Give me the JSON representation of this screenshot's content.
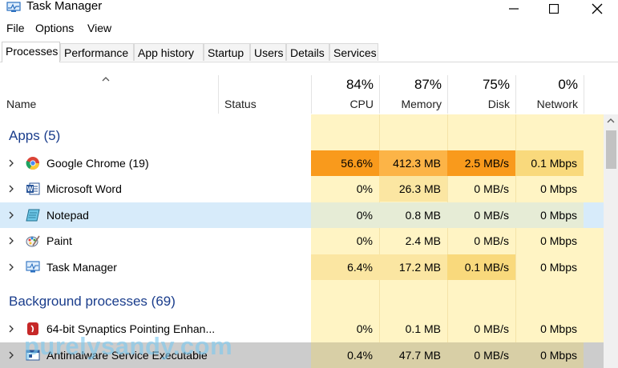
{
  "window": {
    "title": "Task Manager"
  },
  "menu": [
    "File",
    "Options",
    "View"
  ],
  "tabs": [
    "Processes",
    "Performance",
    "App history",
    "Startup",
    "Users",
    "Details",
    "Services"
  ],
  "columns": {
    "name": "Name",
    "status": "Status",
    "cpu": {
      "pct": "84%",
      "label": "CPU"
    },
    "memory": {
      "pct": "87%",
      "label": "Memory"
    },
    "disk": {
      "pct": "75%",
      "label": "Disk"
    },
    "network": {
      "pct": "0%",
      "label": "Network"
    }
  },
  "groups": {
    "apps": "Apps (5)",
    "background": "Background processes (69)"
  },
  "apps": [
    {
      "name": "Google Chrome (19)",
      "cpu": "56.6%",
      "memory": "412.3 MB",
      "disk": "2.5 MB/s",
      "network": "0.1 Mbps",
      "icon": "chrome-icon"
    },
    {
      "name": "Microsoft Word",
      "cpu": "0%",
      "memory": "26.3 MB",
      "disk": "0 MB/s",
      "network": "0 Mbps",
      "icon": "word-icon"
    },
    {
      "name": "Notepad",
      "cpu": "0%",
      "memory": "0.8 MB",
      "disk": "0 MB/s",
      "network": "0 Mbps",
      "icon": "notepad-icon"
    },
    {
      "name": "Paint",
      "cpu": "0%",
      "memory": "2.4 MB",
      "disk": "0 MB/s",
      "network": "0 Mbps",
      "icon": "paint-icon"
    },
    {
      "name": "Task Manager",
      "cpu": "6.4%",
      "memory": "17.2 MB",
      "disk": "0.1 MB/s",
      "network": "0 Mbps",
      "icon": "task-manager-icon"
    }
  ],
  "background": [
    {
      "name": "64-bit Synaptics Pointing Enhan...",
      "cpu": "0%",
      "memory": "0.1 MB",
      "disk": "0 MB/s",
      "network": "0 Mbps",
      "icon": "synaptics-icon"
    },
    {
      "name": "Antimalware Service Executable",
      "cpu": "0.4%",
      "memory": "47.7 MB",
      "disk": "0 MB/s",
      "network": "0 Mbps",
      "icon": "antimalware-icon"
    }
  ],
  "watermark": "purelysandy.com",
  "colors": {
    "heat_light": "#fff4c4",
    "heat_medium": "#fbe6a2",
    "heat_strong": "#f9d97c",
    "heat_orange": "#fcb447",
    "heat_deep_orange": "#f99a1c",
    "selected_row": "#d7ebfa",
    "group_text": "#1a3d8c"
  }
}
